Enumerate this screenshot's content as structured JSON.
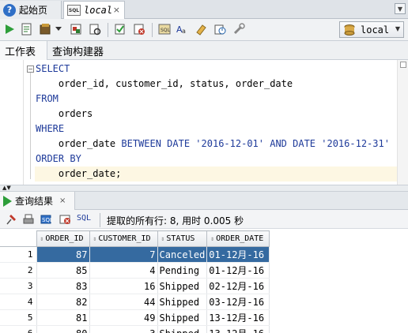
{
  "tabs": [
    {
      "label": "起始页",
      "close": "×"
    },
    {
      "label": "local",
      "close": "×"
    }
  ],
  "tab_dropdown": "▼",
  "connection": {
    "label": "local",
    "dropdown": "▼"
  },
  "worksheet_tabs": [
    "工作表",
    "查询构建器"
  ],
  "editor": {
    "fold_symbol": "−",
    "lines": [
      {
        "kw": "SELECT"
      },
      {
        "text": "    order_id, customer_id, status, order_date"
      },
      {
        "kw": "FROM"
      },
      {
        "text": "    orders"
      },
      {
        "kw": "WHERE"
      },
      {
        "pre": "    order_date ",
        "kw1": "BETWEEN DATE ",
        "s1": "'2016-12-01'",
        "kw2": " AND DATE ",
        "s2": "'2016-12-31'"
      },
      {
        "kw": "ORDER BY"
      },
      {
        "text": "    order_date;"
      }
    ]
  },
  "splitter_arrows": "▲▼",
  "results": {
    "tab_label": "查询结果",
    "tab_close": "×",
    "sql_label": "SQL",
    "fetch_info": "提取的所有行: 8, 用时 0.005 秒",
    "columns": [
      "ORDER_ID",
      "CUSTOMER_ID",
      "STATUS",
      "ORDER_DATE"
    ],
    "rows": [
      {
        "n": "1",
        "order_id": "87",
        "customer_id": "7",
        "status": "Canceled",
        "order_date": "01-12月-16"
      },
      {
        "n": "2",
        "order_id": "85",
        "customer_id": "4",
        "status": "Pending",
        "order_date": "01-12月-16"
      },
      {
        "n": "3",
        "order_id": "83",
        "customer_id": "16",
        "status": "Shipped",
        "order_date": "02-12月-16"
      },
      {
        "n": "4",
        "order_id": "82",
        "customer_id": "44",
        "status": "Shipped",
        "order_date": "03-12月-16"
      },
      {
        "n": "5",
        "order_id": "81",
        "customer_id": "49",
        "status": "Shipped",
        "order_date": "13-12月-16"
      },
      {
        "n": "6",
        "order_id": "80",
        "customer_id": "3",
        "status": "Shipped",
        "order_date": "13-12月-16"
      }
    ]
  },
  "colors": {
    "selection": "#356aa0",
    "keyword": "#1e3a9a",
    "run_green": "#2e9e3a"
  },
  "icons": [
    "help-icon",
    "sql-file-icon",
    "run-statement-icon",
    "run-script-icon",
    "autotrace-icon",
    "explain-plan-icon",
    "sql-tuning-icon",
    "commit-icon",
    "rollback-icon",
    "unshared-sql-icon",
    "format-icon",
    "eraser-icon",
    "history-icon",
    "wrench-icon",
    "database-icon",
    "pin-icon",
    "print-icon",
    "refresh-icon",
    "export-icon"
  ]
}
